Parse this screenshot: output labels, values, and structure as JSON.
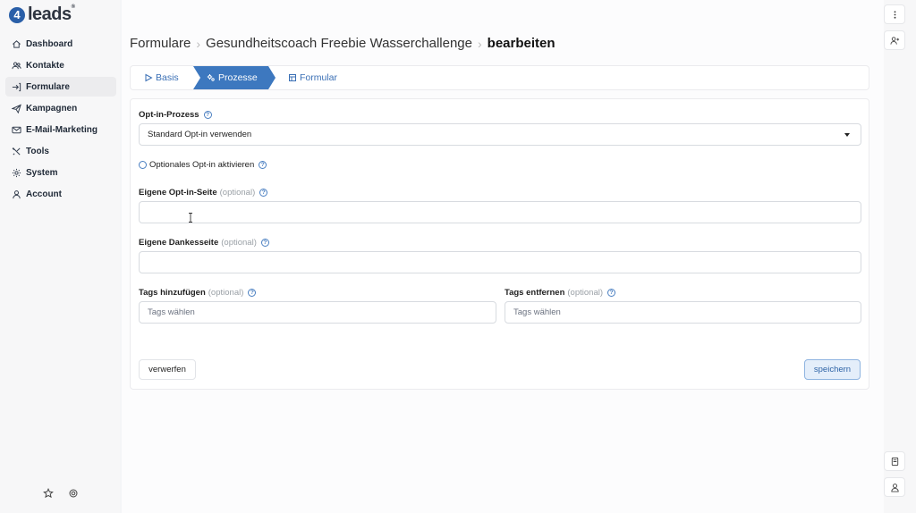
{
  "app": {
    "logo_text": "leads",
    "logo_mark": "4"
  },
  "sidebar": {
    "items": [
      {
        "label": "Dashboard",
        "icon": "home-icon"
      },
      {
        "label": "Kontakte",
        "icon": "users-icon"
      },
      {
        "label": "Formulare",
        "icon": "arrow-in-icon",
        "active": true
      },
      {
        "label": "Kampagnen",
        "icon": "send-icon"
      },
      {
        "label": "E-Mail-Marketing",
        "icon": "mail-icon"
      },
      {
        "label": "Tools",
        "icon": "tools-icon"
      },
      {
        "label": "System",
        "icon": "gear-icon"
      },
      {
        "label": "Account",
        "icon": "user-icon"
      }
    ],
    "bottom_icons": [
      "star-icon",
      "gear-icon"
    ]
  },
  "breadcrumb": {
    "parts": [
      "Formulare",
      "Gesundheitscoach Freebie Wasserchallenge"
    ],
    "current": "bearbeiten"
  },
  "tabs": [
    {
      "label": "Basis",
      "icon": "play-icon"
    },
    {
      "label": "Prozesse",
      "icon": "gears-icon",
      "active": true
    },
    {
      "label": "Formular",
      "icon": "form-icon"
    }
  ],
  "form": {
    "optin_process": {
      "label": "Opt-in-Prozess",
      "value": "Standard Opt-in verwenden"
    },
    "optional_optin": {
      "label": "Optionales Opt-in aktivieren",
      "checked": false
    },
    "optin_page": {
      "label": "Eigene Opt-in-Seite",
      "optional": "(optional)",
      "value": ""
    },
    "thanks_page": {
      "label": "Eigene Dankesseite",
      "optional": "(optional)",
      "value": ""
    },
    "tags_add": {
      "label": "Tags hinzufügen",
      "optional": "(optional)",
      "placeholder": "Tags wählen"
    },
    "tags_remove": {
      "label": "Tags entfernen",
      "optional": "(optional)",
      "placeholder": "Tags wählen"
    },
    "help_glyph": "?"
  },
  "buttons": {
    "discard": "verwerfen",
    "save": "speichern"
  },
  "rail": {
    "icons": [
      "more-vertical-icon",
      "add-user-icon",
      "book-icon",
      "support-icon"
    ]
  },
  "colors": {
    "accent": "#3d78bf",
    "link": "#3a6fb5",
    "save_bg": "#e4eefa"
  }
}
